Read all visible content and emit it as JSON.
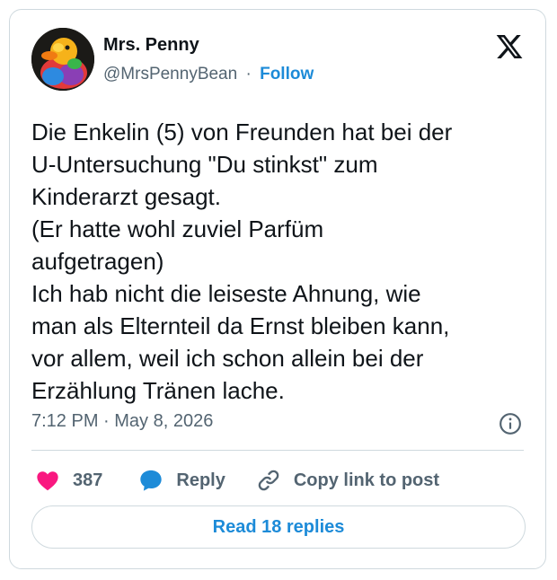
{
  "author": {
    "name": "Mrs. Penny",
    "handle": "@MrsPennyBean",
    "separator": "·",
    "follow_label": "Follow",
    "avatar_icon": "rubber-duck-avatar"
  },
  "tweet": {
    "text": "Die Enkelin (5) von Freunden hat bei der\nU-Untersuchung \"Du stinkst\" zum\nKinderarzt gesagt.\n(Er hatte wohl zuviel Parfüm\naufgetragen)\nIch hab nicht die leiseste Ahnung, wie\nman als Elternteil da Ernst bleiben kann,\nvor allem, weil ich schon allein bei der\nErzählung Tränen lache.",
    "timestamp": "7:12 PM · May 8, 2026"
  },
  "actions": {
    "like_count": "387",
    "reply_label": "Reply",
    "copy_link_label": "Copy link to post"
  },
  "footer": {
    "read_replies_label": "Read 18 replies"
  },
  "colors": {
    "accent": "#1d8bd8",
    "like": "#f91880",
    "secondary_text": "#536471",
    "border": "#cfd9de"
  },
  "icons": {
    "brand": "x-logo-icon",
    "info": "info-icon",
    "like": "heart-icon",
    "reply": "speech-bubble-icon",
    "copy": "link-icon"
  }
}
